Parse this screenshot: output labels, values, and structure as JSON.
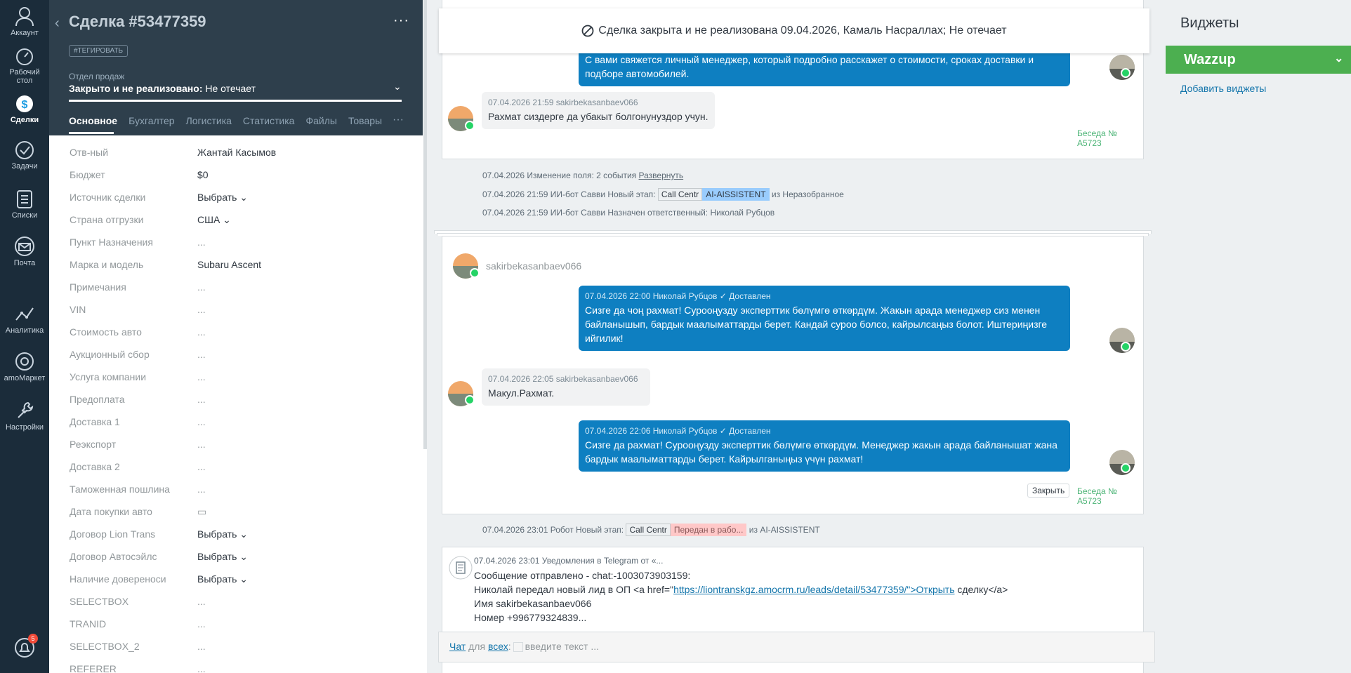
{
  "nav": {
    "items": [
      {
        "label": "Аккаунт",
        "icon": "user-icon"
      },
      {
        "label": "Рабочий стол",
        "icon": "dashboard-icon"
      },
      {
        "label": "Сделки",
        "icon": "deals-icon",
        "active": true
      },
      {
        "label": "Задачи",
        "icon": "check-icon"
      },
      {
        "label": "Списки",
        "icon": "list-icon"
      },
      {
        "label": "Почта",
        "icon": "mail-icon"
      },
      {
        "label": "Аналитика",
        "icon": "analytics-icon"
      },
      {
        "label": "amoМаркет",
        "icon": "market-icon"
      },
      {
        "label": "Настройки",
        "icon": "settings-icon"
      }
    ],
    "notifications_badge": "5"
  },
  "card": {
    "title": "Сделка #53477359",
    "tag_button": "#ТЕГИРОВАТЬ",
    "pipeline": "Отдел продаж",
    "status_bold": "Закрыто и не реализовано:",
    "status_reason": " Не отечает",
    "tabs": [
      "Основное",
      "Бухгалтерия",
      "Логистика",
      "Статистика",
      "Файлы",
      "Товары"
    ],
    "tabs_display": [
      "Основное",
      "Бухгалтер",
      "Логистика",
      "Статистика",
      "Файлы",
      "Товары"
    ]
  },
  "fields": [
    {
      "label": "Отв-ный",
      "value": "Жантай Касымов"
    },
    {
      "label": "Бюджет",
      "value": "$0"
    },
    {
      "label": "Источник сделки",
      "value": "Выбрать ⌄"
    },
    {
      "label": "Страна отгрузки",
      "value": "США ⌄"
    },
    {
      "label": "Пункт Назначения",
      "value": "..."
    },
    {
      "label": "Марка и модель",
      "value": "Subaru Ascent"
    },
    {
      "label": "Примечания",
      "value": "..."
    },
    {
      "label": "VIN",
      "value": "..."
    },
    {
      "label": "Стоимость авто",
      "value": "..."
    },
    {
      "label": "Аукционный сбор",
      "value": "..."
    },
    {
      "label": "Услуга компании",
      "value": "..."
    },
    {
      "label": "Предоплата",
      "value": "..."
    },
    {
      "label": "Доставка 1",
      "value": "..."
    },
    {
      "label": "Реэкспорт",
      "value": "..."
    },
    {
      "label": "Доставка 2",
      "value": "..."
    },
    {
      "label": "Таможенная пошлина",
      "value": "..."
    },
    {
      "label": "Дата покупки авто",
      "value": "▭"
    },
    {
      "label": "Договор Lion Trans",
      "value": "Выбрать ⌄"
    },
    {
      "label": "Договор Автосэйлс",
      "value": "Выбрать ⌄"
    },
    {
      "label": "Наличие довереноси",
      "value": "Выбрать ⌄"
    },
    {
      "label": "SELECTBOX",
      "value": "..."
    },
    {
      "label": "TRANID",
      "value": "..."
    },
    {
      "label": "SELECTBOX_2",
      "value": "..."
    },
    {
      "label": "REFERER",
      "value": "..."
    }
  ],
  "banner": {
    "text": "Сделка закрыта и не реализована 09.04.2026, Камаль Насраллах; Не отечает"
  },
  "feed": {
    "top_message_text": "С вами свяжется личный менеджер, который подробно расскажет о стоимости, сроках доставки и подборе автомобилей.",
    "msg1": {
      "meta": "07.04.2026 21:59 sakirbekasanbaev066",
      "text": "Рахмат сиздерге да убакыт болгонунуздор учун."
    },
    "conv_link_1": "Беседа № A5723",
    "event1": {
      "text": "07.04.2026 Изменение поля: 2 события",
      "link": "Развернуть"
    },
    "event2": {
      "prefix": "07.04.2026 21:59 ИИ-бот Савви Новый этап:",
      "chip1": "Call Centr",
      "chip2": "AI-AISSISTENT",
      "suffix": "из Неразобранное"
    },
    "event3": "07.04.2026 21:59 ИИ-бот Савви Назначен ответственный: Николай Рубцов",
    "conv_header_name": "sakirbekasanbaev066",
    "msg2": {
      "meta_time": "07.04.2026 22:00 Николай Рубцов",
      "meta_status": "Доставлен",
      "text": "Сизге да чоң рахмат! Суроoңузду эксперттик бөлүмгө өткөрдүм. Жакын арада менеджер сиз менен байланышып, бардык маалыматтарды берет. Кандай суроо болсо, кайрылсаңыз болот. Иштериңизге ийгилик!"
    },
    "msg3": {
      "meta": "07.04.2026 22:05 sakirbekasanbaev066",
      "text": "Макул.Рахмат."
    },
    "msg4": {
      "meta_time": "07.04.2026 22:06 Николай Рубцов",
      "meta_status": "Доставлен",
      "text": "Сизге да рахмат! Суроoңузду эксперттик бөлүмгө өткөрдүм. Менеджер жакын арада байланышат жана бардык маалыматтарды берет. Кайрылганыңыз үчүн рахмат!"
    },
    "close_button": "Закрыть",
    "conv_link_2": "Беседа № A5723",
    "event4": {
      "prefix": "07.04.2026 23:01 Робот Новый этап:",
      "chip1": "Call Centr",
      "chip2": "Передан в рабо...",
      "suffix": "из AI-AISSISTENT"
    },
    "notice": {
      "meta": "07.04.2026 23:01 Уведомления в Telegram от «...",
      "line1": "Сообщение отправлено - chat:-1003073903159:",
      "line2_prefix": "Николай передал новый лид в ОП <a href=\"",
      "line2_link": "https://liontranskgz.amocrm.ru/leads/detail/53477359/\">Открыть",
      "line2_suffix": " сделку</a>",
      "line3": "Имя sakirbekasanbaev066",
      "line4": "Номер +996779324839..."
    }
  },
  "chat_input": {
    "chat": "Чат",
    "for": " для ",
    "all": "всех",
    "placeholder": "введите текст ..."
  },
  "widgets": {
    "title": "Виджеты",
    "wazzup": "Wazzup",
    "add": "Добавить виджеты"
  },
  "colors": {
    "nav_bg": "#1b2c3a",
    "card_head_bg": "#2e3f4c",
    "message_blue": "#0e7fc1",
    "wazzup_green": "#4caf50",
    "link_blue": "#1375ab"
  }
}
